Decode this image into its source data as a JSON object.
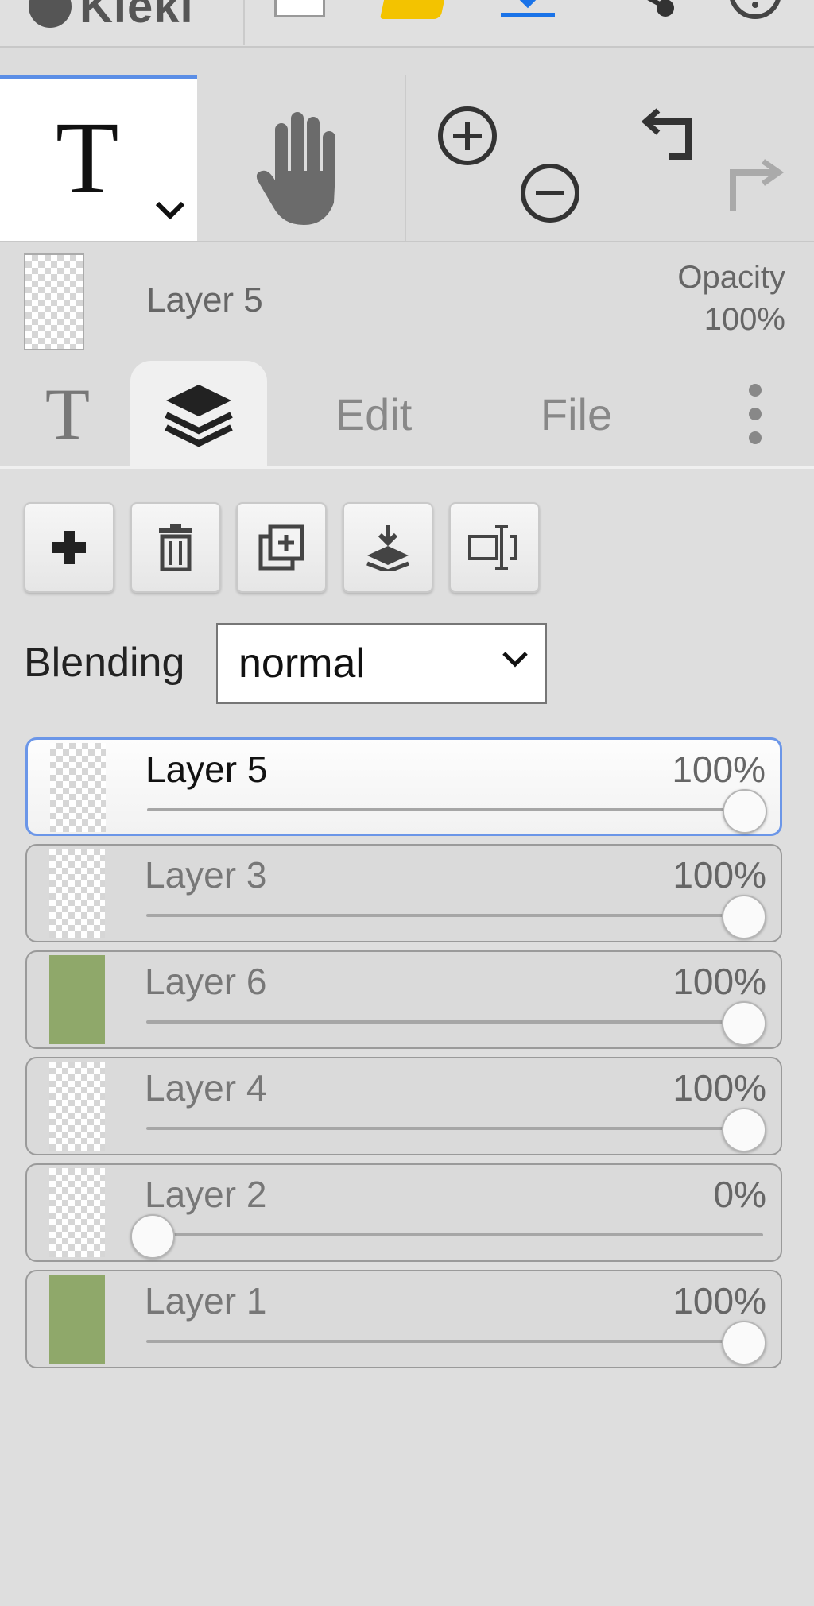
{
  "app": {
    "title": "Kleki"
  },
  "topbar": {
    "icons": [
      "new-image-icon",
      "open-folder-icon",
      "download-icon",
      "share-icon",
      "help-icon"
    ]
  },
  "tools": {
    "active": "text-tool",
    "items": [
      "text-tool",
      "hand-tool",
      "zoom-in",
      "zoom-out",
      "undo",
      "redo"
    ]
  },
  "current_layer": {
    "name": "Layer 5",
    "opacity_label": "Opacity",
    "opacity_value": "100%"
  },
  "tabs": {
    "items": [
      {
        "id": "text",
        "label": ""
      },
      {
        "id": "layers",
        "label": ""
      },
      {
        "id": "edit",
        "label": "Edit"
      },
      {
        "id": "file",
        "label": "File"
      },
      {
        "id": "more",
        "label": ""
      }
    ],
    "active": "layers"
  },
  "layer_actions": [
    "add-layer",
    "delete-layer",
    "duplicate-layer",
    "merge-down",
    "rename-layer"
  ],
  "blending": {
    "label": "Blending",
    "value": "normal"
  },
  "layers": [
    {
      "name": "Layer 5",
      "percent": "100%",
      "opacity": 1.0,
      "active": true,
      "thumb": "transparent"
    },
    {
      "name": "Layer 3",
      "percent": "100%",
      "opacity": 1.0,
      "active": false,
      "thumb": "transparent"
    },
    {
      "name": "Layer 6",
      "percent": "100%",
      "opacity": 1.0,
      "active": false,
      "thumb": "green"
    },
    {
      "name": "Layer 4",
      "percent": "100%",
      "opacity": 1.0,
      "active": false,
      "thumb": "transparent"
    },
    {
      "name": "Layer 2",
      "percent": "0%",
      "opacity": 0.0,
      "active": false,
      "thumb": "transparent"
    },
    {
      "name": "Layer 1",
      "percent": "100%",
      "opacity": 1.0,
      "active": false,
      "thumb": "green"
    }
  ],
  "colors": {
    "accent": "#5b8ee6",
    "panel": "#dedede",
    "thumb_green": "#8fa86a"
  }
}
